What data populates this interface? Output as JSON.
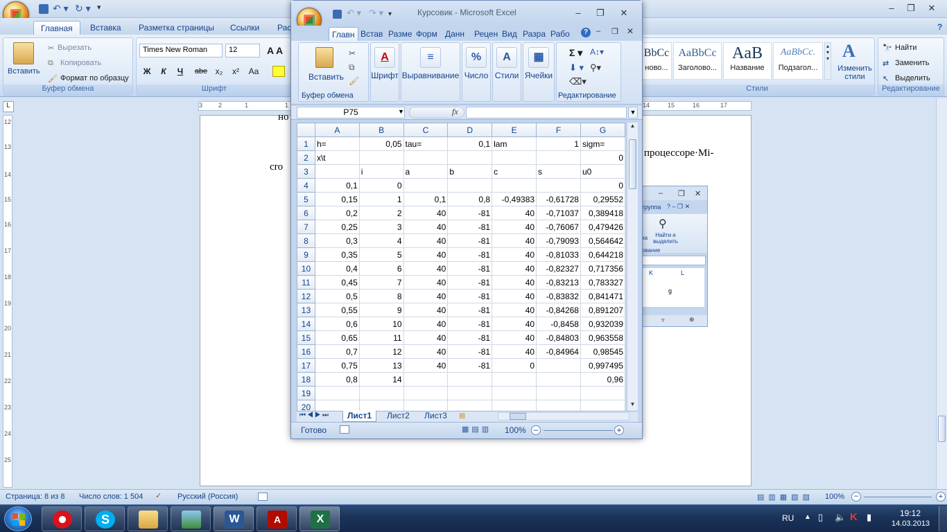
{
  "word": {
    "title_hidden": "",
    "tabs": [
      "Главная",
      "Вставка",
      "Разметка страницы",
      "Ссылки",
      "Рас"
    ],
    "clipboard": {
      "paste": "Вставить",
      "cut": "Вырезать",
      "copy": "Копировать",
      "format_painter": "Формат по образцу",
      "label": "Буфер обмена"
    },
    "font": {
      "family": "Times New Roman",
      "size": "12",
      "label": "Шрифт",
      "bold": "Ж",
      "italic": "К",
      "underline": "Ч",
      "strike": "abe",
      "sub": "x₂",
      "sup": "x²",
      "case": "Aa"
    },
    "styles": {
      "items": [
        {
          "sample": "BbCc",
          "name": "ново..."
        },
        {
          "sample": "AaBbCc",
          "name": "Заголово..."
        },
        {
          "sample": "AaB",
          "name": "Название"
        },
        {
          "sample": "AaBbCc.",
          "name": "Подзагол..."
        }
      ],
      "change": "Изменить стили",
      "label": "Стили"
    },
    "editing": {
      "find": "Найти",
      "replace": "Заменить",
      "select": "Выделить",
      "label": "Редактирование"
    },
    "page_text": {
      "line1": "но",
      "line2_right": "процессоре·Mi-",
      "line3": "cro"
    },
    "status": {
      "page": "Страница: 8 из 8",
      "words": "Число слов: 1 504",
      "lang": "Русский (Россия)",
      "zoom": "100%"
    },
    "ruler_h": [
      "3",
      "2",
      "1",
      "1",
      "2",
      "3",
      "14",
      "15",
      "16",
      "17"
    ],
    "ruler_v": [
      "12",
      "1",
      "13",
      "14",
      "15",
      "16",
      "17",
      "18",
      "19",
      "20",
      "21",
      "22",
      "23",
      "24",
      "25"
    ]
  },
  "excel": {
    "title": "Курсовик - Microsoft Excel",
    "tabs": [
      "Главн",
      "Встав",
      "Разме",
      "Форм",
      "Данн",
      "Рецен",
      "Вид",
      "Разра",
      "Рабо"
    ],
    "groups": {
      "paste": "Вставить",
      "clipboard": "Буфер обмена",
      "font": "Шрифт",
      "align": "Выравнивание",
      "number": "Число",
      "styles": "Стили",
      "cells": "Ячейки",
      "editing": "Редактирование"
    },
    "name_box": "P75",
    "fx": "fx",
    "columns": [
      "A",
      "B",
      "C",
      "D",
      "E",
      "F",
      "G"
    ],
    "rows": [
      {
        "n": "1",
        "c": [
          "h=",
          "0,05",
          "tau=",
          "0,1",
          "lam",
          "1",
          "sigm="
        ]
      },
      {
        "n": "2",
        "c": [
          "x\\t",
          "",
          "",
          "",
          "",
          "",
          "0"
        ]
      },
      {
        "n": "3",
        "c": [
          "",
          "i",
          "a",
          "b",
          "c",
          "s",
          "u0"
        ]
      },
      {
        "n": "4",
        "c": [
          "0,1",
          "0",
          "",
          "",
          "",
          "",
          "0"
        ]
      },
      {
        "n": "5",
        "c": [
          "0,15",
          "1",
          "0,1",
          "0,8",
          "-0,49383",
          "-0,61728",
          "0,29552"
        ]
      },
      {
        "n": "6",
        "c": [
          "0,2",
          "2",
          "40",
          "-81",
          "40",
          "-0,71037",
          "0,389418"
        ]
      },
      {
        "n": "7",
        "c": [
          "0,25",
          "3",
          "40",
          "-81",
          "40",
          "-0,76067",
          "0,479426"
        ]
      },
      {
        "n": "8",
        "c": [
          "0,3",
          "4",
          "40",
          "-81",
          "40",
          "-0,79093",
          "0,564642"
        ]
      },
      {
        "n": "9",
        "c": [
          "0,35",
          "5",
          "40",
          "-81",
          "40",
          "-0,81033",
          "0,644218"
        ]
      },
      {
        "n": "10",
        "c": [
          "0,4",
          "6",
          "40",
          "-81",
          "40",
          "-0,82327",
          "0,717356"
        ]
      },
      {
        "n": "11",
        "c": [
          "0,45",
          "7",
          "40",
          "-81",
          "40",
          "-0,83213",
          "0,783327"
        ]
      },
      {
        "n": "12",
        "c": [
          "0,5",
          "8",
          "40",
          "-81",
          "40",
          "-0,83832",
          "0,841471"
        ]
      },
      {
        "n": "13",
        "c": [
          "0,55",
          "9",
          "40",
          "-81",
          "40",
          "-0,84268",
          "0,891207"
        ]
      },
      {
        "n": "14",
        "c": [
          "0,6",
          "10",
          "40",
          "-81",
          "40",
          "-0,8458",
          "0,932039"
        ]
      },
      {
        "n": "15",
        "c": [
          "0,65",
          "11",
          "40",
          "-81",
          "40",
          "-0,84803",
          "0,963558"
        ]
      },
      {
        "n": "16",
        "c": [
          "0,7",
          "12",
          "40",
          "-81",
          "40",
          "-0,84964",
          "0,98545"
        ]
      },
      {
        "n": "17",
        "c": [
          "0,75",
          "13",
          "40",
          "-81",
          "0",
          "",
          "0,997495"
        ]
      },
      {
        "n": "18",
        "c": [
          "0,8",
          "14",
          "",
          "",
          "",
          "",
          "0,96"
        ]
      },
      {
        "n": "19",
        "c": [
          "",
          "",
          "",
          "",
          "",
          "",
          ""
        ]
      },
      {
        "n": "20",
        "c": [
          "",
          "",
          "",
          "",
          "",
          "",
          ""
        ]
      }
    ],
    "sheets": [
      "Лист1",
      "Лист2",
      "Лист3"
    ],
    "status": {
      "ready": "Готово",
      "zoom": "100%"
    }
  },
  "mini_excel": {
    "group": "группа",
    "find": "Найти и выделить",
    "editing_partial": "ование",
    "cols": [
      "K",
      "L"
    ],
    "cell": "g",
    "ka": "ка"
  },
  "taskbar": {
    "lang": "RU",
    "time": "19:12",
    "date": "14.03.2013"
  }
}
